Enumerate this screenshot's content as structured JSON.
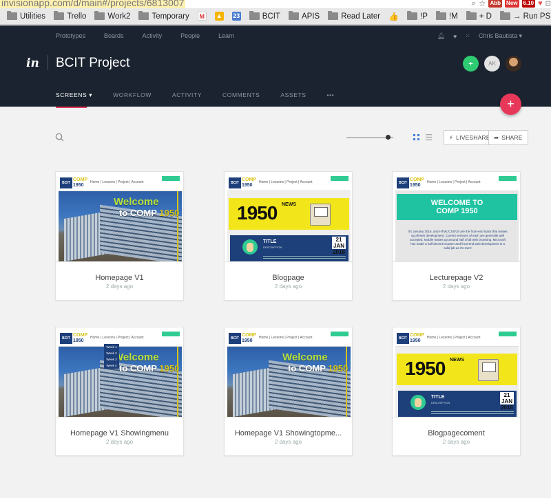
{
  "browser": {
    "url": "invisionapp.com/d/main#/projects/6813007",
    "extensions": [
      "Abb",
      "New",
      "6.10"
    ],
    "bookmarks": [
      "Utilities",
      "Trello",
      "Work2",
      "Temporary",
      "BCIT",
      "APIS",
      "Read Later",
      "!P",
      "!M",
      "+ D",
      "→ Run PS"
    ]
  },
  "app": {
    "topnav": [
      "Prototypes",
      "Boards",
      "Activity",
      "People",
      "Learn"
    ],
    "user_name": "Chris Bautista",
    "logo": "in",
    "project_title": "BCIT Project",
    "avatar_initials": "AK",
    "tabs": [
      "SCREENS",
      "WORKFLOW",
      "ACTIVITY",
      "COMMENTS",
      "ASSETS",
      "•••"
    ],
    "active_tab": "SCREENS",
    "fab_label": "+",
    "liveshare_label": "LIVESHARE",
    "share_label": "SHARE",
    "accent_color": "#e8385a"
  },
  "screens": [
    {
      "name": "Homepage V1",
      "date": "2 days ago",
      "thumb": "welcome"
    },
    {
      "name": "Blogpage",
      "date": "2 days ago",
      "thumb": "news"
    },
    {
      "name": "Lecturepage V2",
      "date": "2 days ago",
      "thumb": "lecture"
    },
    {
      "name": "Homepage V1 Showingmenu",
      "date": "2 days ago",
      "thumb": "menu"
    },
    {
      "name": "Homepage V1 Showingtopme...",
      "date": "2 days ago",
      "thumb": "welcome"
    },
    {
      "name": "Blogpagecoment",
      "date": "2 days ago",
      "thumb": "news"
    }
  ],
  "thumb_text": {
    "bcit": "BCIT",
    "comp": "COMP",
    "year": "1950",
    "links": "Home | Lessons | Project | Account",
    "welcome_l1": "Welcome",
    "welcome_l2a": "to COMP ",
    "welcome_l2b": "1950",
    "news": "NEWS",
    "post_title": "TITLE",
    "post_desc": "DESCRIPTION",
    "post_date": "21 JAN 2016",
    "lecture_l1": "WELCOME TO",
    "lecture_l2": "COMP 1950",
    "lecture_body": "It's January 2016, and HTML/CSS/JS are the front-end stack that makes up all web development. Current versions of each are generally well accepted. Mobile makes up around half of all web browsing. Microsoft has made a half decent browser and front-end web development is a solid job as it's ever!",
    "menu_items": [
      "Week 1",
      "Week 2",
      "Week 3",
      "Week 4"
    ]
  }
}
